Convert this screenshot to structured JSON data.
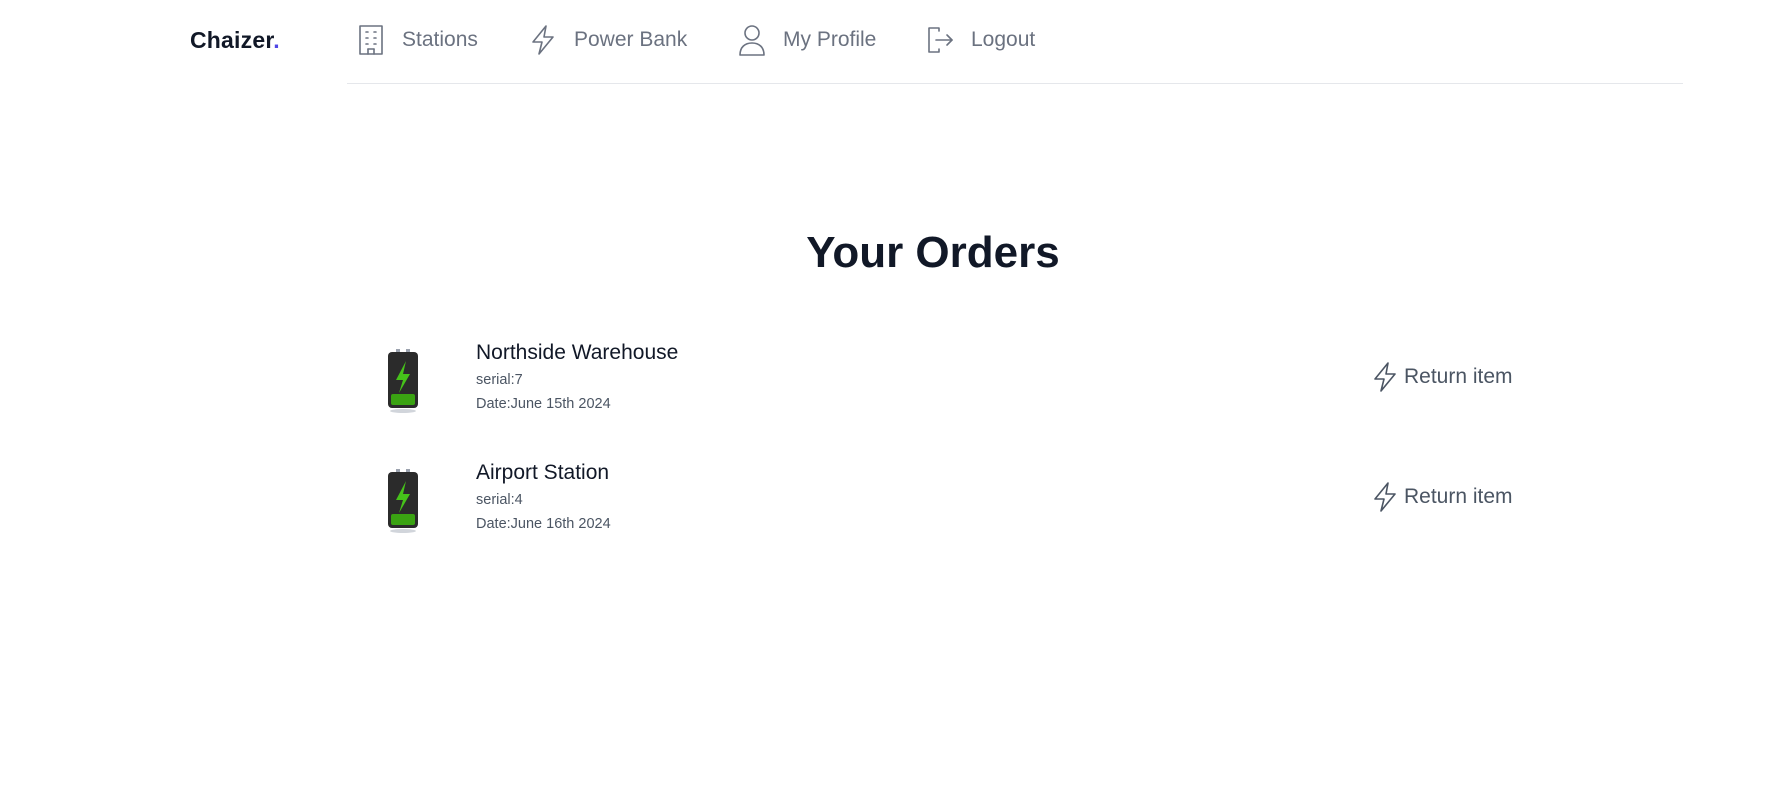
{
  "header": {
    "brand": "Chaizer",
    "brand_dot": ".",
    "nav": [
      {
        "label": "Stations",
        "icon": "building-icon"
      },
      {
        "label": "Power Bank",
        "icon": "bolt-icon"
      },
      {
        "label": "My Profile",
        "icon": "user-icon"
      },
      {
        "label": "Logout",
        "icon": "logout-icon"
      }
    ]
  },
  "main": {
    "title": "Your Orders",
    "orders": [
      {
        "station": "Northside Warehouse",
        "serial": "serial:7",
        "date": "Date:June 15th 2024",
        "action": "Return item",
        "icon": "battery-icon"
      },
      {
        "station": "Airport Station",
        "serial": "serial:4",
        "date": "Date:June 16th 2024",
        "action": "Return item",
        "icon": "battery-icon"
      }
    ]
  },
  "colors": {
    "accent": "#4f46e5",
    "text": "#111827",
    "muted": "#6b7280",
    "battery_green": "#3aa312"
  }
}
